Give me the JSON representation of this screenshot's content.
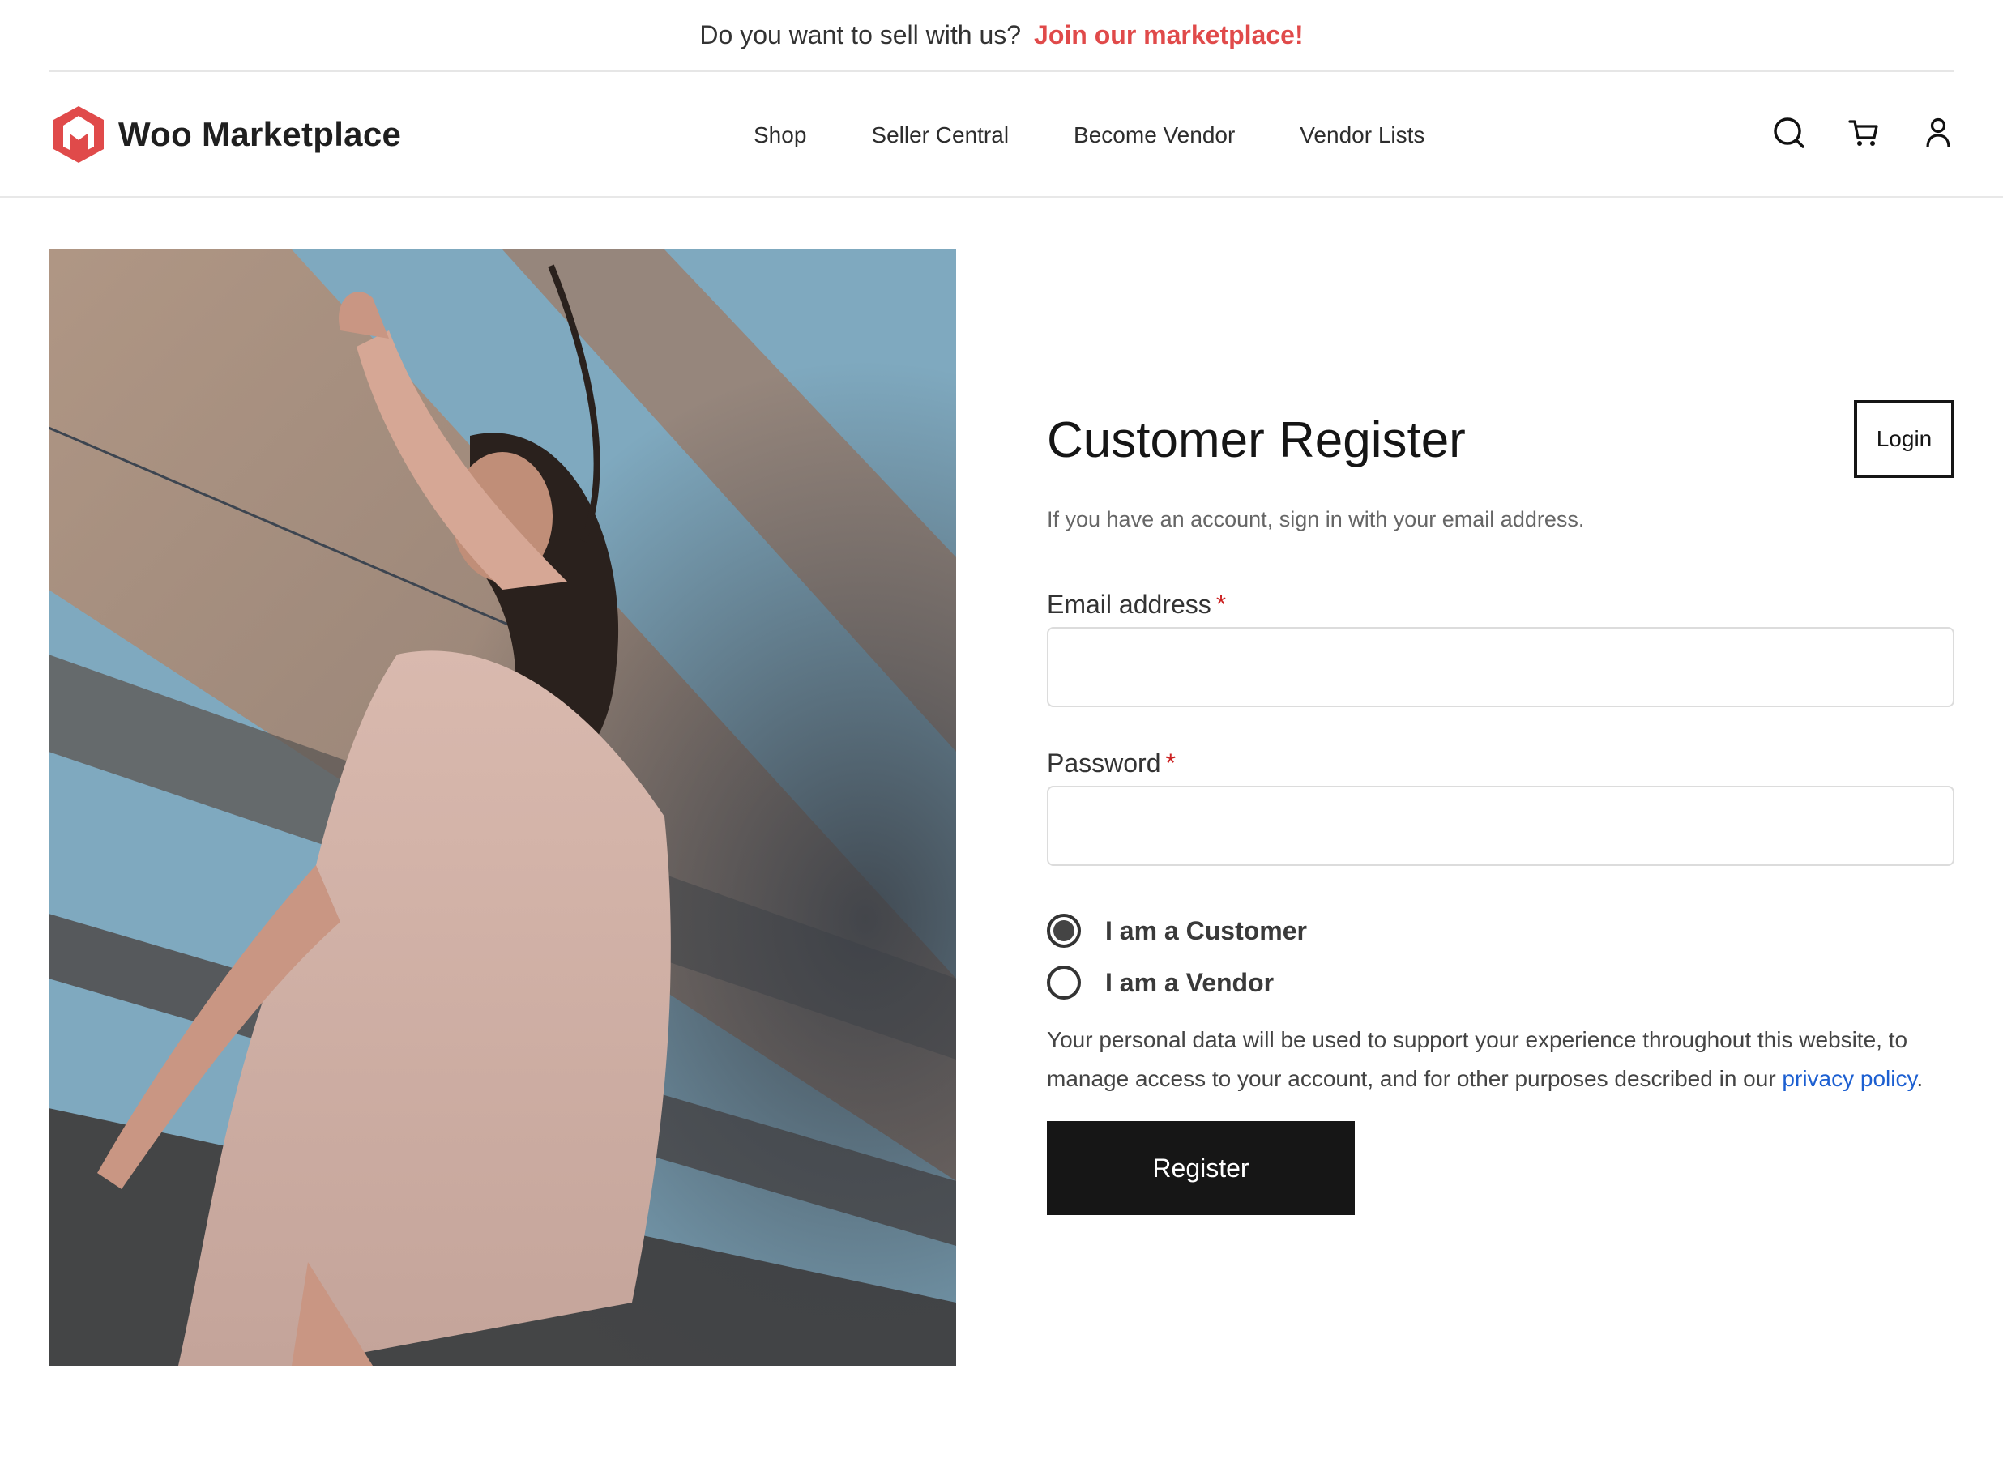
{
  "announcement": {
    "question": "Do you want to sell with us?",
    "link_label": "Join our marketplace!"
  },
  "header": {
    "brand": "Woo Marketplace",
    "nav": [
      "Shop",
      "Seller Central",
      "Become Vendor",
      "Vendor Lists"
    ],
    "icons": [
      "search-icon",
      "cart-icon",
      "user-icon"
    ]
  },
  "form": {
    "title": "Customer Register",
    "login_label": "Login",
    "subtitle": "If you have an account, sign in with your email address.",
    "email_label": "Email address",
    "email_value": "",
    "password_label": "Password",
    "password_value": "",
    "required_mark": "*",
    "roles": [
      {
        "label": "I am a Customer",
        "selected": true
      },
      {
        "label": "I am a Vendor",
        "selected": false
      }
    ],
    "privacy_text": "Your personal data will be used to support your experience throughout this website, to manage access to your account, and for other purposes described in our",
    "privacy_link": "privacy policy",
    "privacy_end": ".",
    "register_label": "Register"
  },
  "colors": {
    "accent": "#e04a4a",
    "link": "#1c5fd1",
    "button": "#161616"
  }
}
